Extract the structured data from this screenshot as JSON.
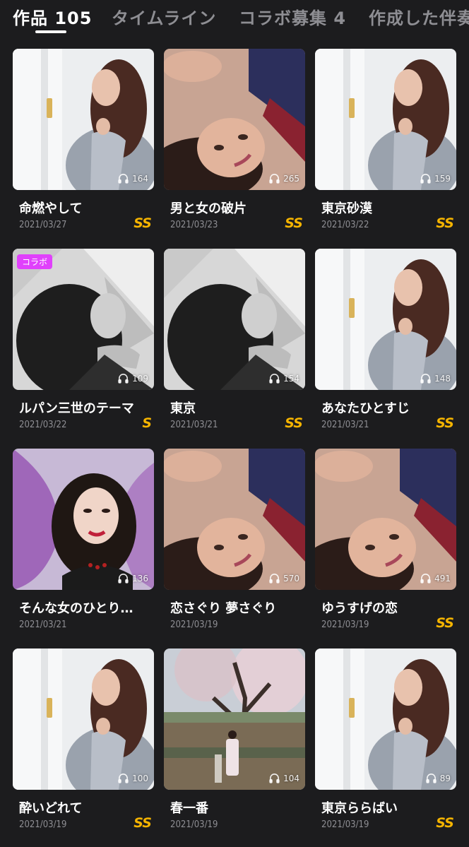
{
  "tabs": [
    {
      "label": "作品 105",
      "active": true
    },
    {
      "label": "タイムライン",
      "active": false
    },
    {
      "label": "コラボ募集 4",
      "active": false
    },
    {
      "label": "作成した伴奏",
      "active": false
    }
  ],
  "works": [
    {
      "title": "命燃やして",
      "date": "2021/03/27",
      "plays": "164",
      "grade": "SS",
      "collab": "",
      "art": "window-woman"
    },
    {
      "title": "男と女の破片",
      "date": "2021/03/23",
      "plays": "265",
      "grade": "SS",
      "collab": "",
      "art": "lying-woman"
    },
    {
      "title": "東京砂漠",
      "date": "2021/03/22",
      "plays": "159",
      "grade": "SS",
      "collab": "",
      "art": "window-woman"
    },
    {
      "title": "ルパン三世のテーマ",
      "date": "2021/03/22",
      "plays": "109",
      "grade": "S",
      "collab": "コラボ",
      "art": "monochrome-woman"
    },
    {
      "title": "東京",
      "date": "2021/03/21",
      "plays": "154",
      "grade": "SS",
      "collab": "",
      "art": "monochrome-woman"
    },
    {
      "title": "あなたひとすじ",
      "date": "2021/03/21",
      "plays": "148",
      "grade": "SS",
      "collab": "",
      "art": "window-woman"
    },
    {
      "title": "そんな女のひとり…",
      "date": "2021/03/21",
      "plays": "136",
      "grade": "",
      "collab": "",
      "art": "purple-woman"
    },
    {
      "title": "恋さぐり 夢さぐり",
      "date": "2021/03/19",
      "plays": "570",
      "grade": "",
      "collab": "",
      "art": "lying-woman"
    },
    {
      "title": "ゆうすげの恋",
      "date": "2021/03/19",
      "plays": "491",
      "grade": "SS",
      "collab": "",
      "art": "lying-woman"
    },
    {
      "title": "酔いどれて",
      "date": "2021/03/19",
      "plays": "100",
      "grade": "SS",
      "collab": "",
      "art": "window-woman"
    },
    {
      "title": "春一番",
      "date": "2021/03/19",
      "plays": "104",
      "grade": "",
      "collab": "",
      "art": "cherry-tree-kimono"
    },
    {
      "title": "東京ららばい",
      "date": "2021/03/19",
      "plays": "89",
      "grade": "SS",
      "collab": "",
      "art": "window-woman"
    }
  ],
  "icons": {
    "plays": "headphones-icon"
  },
  "colors": {
    "background": "#1c1c1e",
    "grade": "#f5b400",
    "collab_badge": "#e040fb",
    "muted_text": "#8e8e93"
  }
}
